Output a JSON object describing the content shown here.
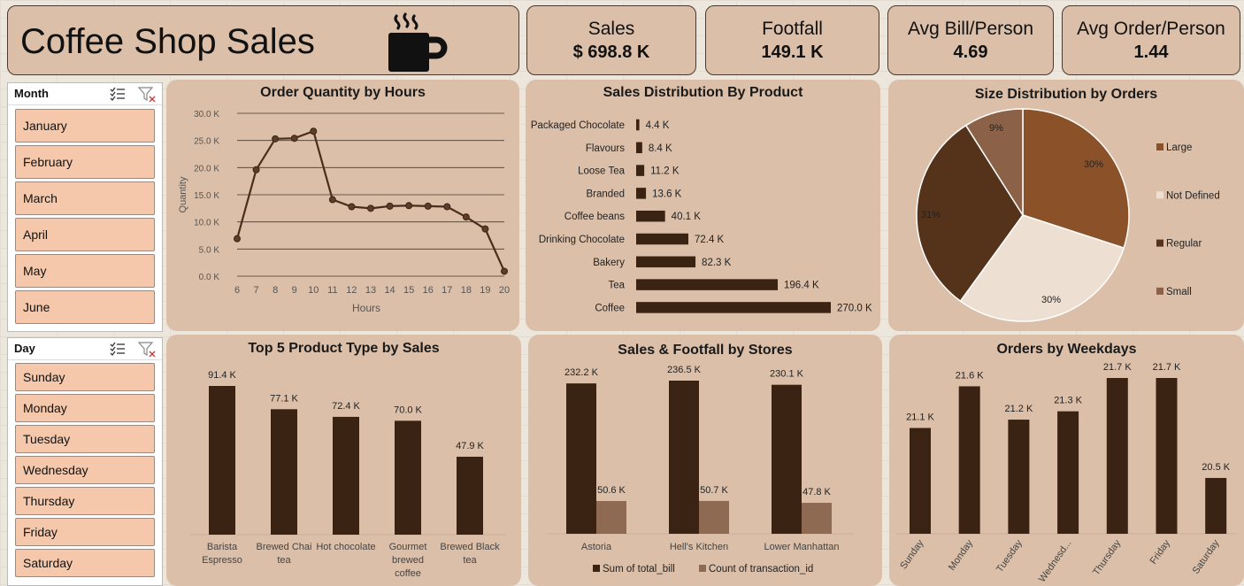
{
  "header": {
    "title": "Coffee Shop Sales"
  },
  "kpis": [
    {
      "label": "Sales",
      "value": "$ 698.8 K"
    },
    {
      "label": "Footfall",
      "value": "149.1 K"
    },
    {
      "label": "Avg Bill/Person",
      "value": "4.69"
    },
    {
      "label": "Avg Order/Person",
      "value": "1.44"
    }
  ],
  "slicers": {
    "month": {
      "title": "Month",
      "items": [
        "January",
        "February",
        "March",
        "April",
        "May",
        "June"
      ]
    },
    "day": {
      "title": "Day",
      "items": [
        "Sunday",
        "Monday",
        "Tuesday",
        "Wednesday",
        "Thursday",
        "Friday",
        "Saturday"
      ]
    }
  },
  "colors": {
    "panel": "#dbbfa8",
    "dark_bar": "#3b2314",
    "light_bar": "#8f6a52",
    "slicer_button": "#f5c8ac"
  },
  "icons": [
    "coffee-cup-icon",
    "multi-select-icon",
    "clear-filter-icon"
  ],
  "chart_data": [
    {
      "id": "hours",
      "type": "line",
      "title": "Order Quantity by Hours",
      "xlabel": "Hours",
      "ylabel": "Quantity",
      "x": [
        6,
        7,
        8,
        9,
        10,
        11,
        12,
        13,
        14,
        15,
        16,
        17,
        18,
        19,
        20
      ],
      "values": [
        6900,
        19600,
        25300,
        25400,
        26700,
        14100,
        12800,
        12500,
        12900,
        13000,
        12900,
        12800,
        10900,
        8700,
        900
      ],
      "ylim": [
        0,
        30000
      ],
      "yticks": [
        "0.0 K",
        "5.0 K",
        "10.0 K",
        "15.0 K",
        "20.0 K",
        "25.0 K",
        "30.0 K"
      ],
      "grid": true
    },
    {
      "id": "product",
      "type": "bar",
      "orientation": "horizontal",
      "title": "Sales Distribution By Product",
      "categories": [
        "Packaged Chocolate",
        "Flavours",
        "Loose Tea",
        "Branded",
        "Coffee beans",
        "Drinking Chocolate",
        "Bakery",
        "Tea",
        "Coffee"
      ],
      "values": [
        4.4,
        8.4,
        11.2,
        13.6,
        40.1,
        72.4,
        82.3,
        196.4,
        270.0
      ],
      "labels": [
        "4.4 K",
        "8.4 K",
        "11.2 K",
        "13.6 K",
        "40.1 K",
        "72.4 K",
        "82.3 K",
        "196.4 K",
        "270.0 K"
      ]
    },
    {
      "id": "size",
      "type": "pie",
      "title": "Size Distribution by Orders",
      "categories": [
        "Large",
        "Not Defined",
        "Regular",
        "Small"
      ],
      "values": [
        30,
        30,
        31,
        9
      ],
      "labels": [
        "30%",
        "30%",
        "31%",
        "9%"
      ],
      "colors": [
        "#8b5229",
        "#ede0d2",
        "#55321a",
        "#8b6147"
      ],
      "legend": "right"
    },
    {
      "id": "top5",
      "type": "bar",
      "title": "Top 5 Product Type by Sales",
      "categories": [
        "Barista Espresso",
        "Brewed Chai tea",
        "Hot chocolate",
        "Gourmet brewed coffee",
        "Brewed Black tea"
      ],
      "values": [
        91.4,
        77.1,
        72.4,
        70.0,
        47.9
      ],
      "labels": [
        "91.4 K",
        "77.1 K",
        "72.4 K",
        "70.0 K",
        "47.9 K"
      ]
    },
    {
      "id": "stores",
      "type": "bar",
      "title": "Sales & Footfall by Stores",
      "categories": [
        "Astoria",
        "Hell's Kitchen",
        "Lower Manhattan"
      ],
      "series": [
        {
          "name": "Sum of total_bill",
          "values": [
            232.2,
            236.5,
            230.1
          ],
          "labels": [
            "232.2 K",
            "236.5 K",
            "230.1 K"
          ]
        },
        {
          "name": "Count of transaction_id",
          "values": [
            50.6,
            50.7,
            47.8
          ],
          "labels": [
            "50.6 K",
            "50.7 K",
            "47.8 K"
          ]
        }
      ],
      "legend": "bottom"
    },
    {
      "id": "weekdays",
      "type": "bar",
      "title": "Orders by Weekdays",
      "categories": [
        "Sunday",
        "Monday",
        "Tuesday",
        "Wednesd...",
        "Thursday",
        "Friday",
        "Saturday"
      ],
      "values": [
        21.1,
        21.6,
        21.2,
        21.3,
        21.7,
        21.7,
        20.5
      ],
      "labels": [
        "21.1 K",
        "21.6 K",
        "21.2 K",
        "21.3 K",
        "21.7 K",
        "21.7 K",
        "20.5 K"
      ]
    }
  ]
}
